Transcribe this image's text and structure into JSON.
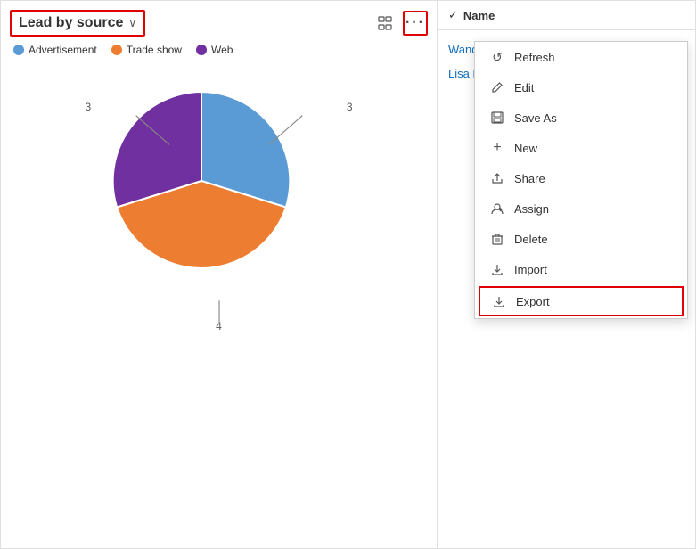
{
  "chart": {
    "title": "Lead by source",
    "chevron": "∨",
    "legend": [
      {
        "label": "Advertisement",
        "color": "#5b9bd5"
      },
      {
        "label": "Trade show",
        "color": "#ed7d31"
      },
      {
        "label": "Web",
        "color": "#7030a0"
      }
    ],
    "pie_labels": [
      {
        "value": "3",
        "position": "top-left"
      },
      {
        "value": "3",
        "position": "top-right"
      },
      {
        "value": "4",
        "position": "bottom"
      }
    ]
  },
  "right_panel": {
    "column_header": "Name",
    "names": [
      {
        "text": "Wanda Graves"
      },
      {
        "text": "Lisa Byrd"
      }
    ]
  },
  "menu": {
    "items": [
      {
        "id": "refresh",
        "label": "Refresh",
        "icon": "↺"
      },
      {
        "id": "edit",
        "label": "Edit",
        "icon": "✎"
      },
      {
        "id": "save-as",
        "label": "Save As",
        "icon": "⊞"
      },
      {
        "id": "new",
        "label": "New",
        "icon": "+"
      },
      {
        "id": "share",
        "label": "Share",
        "icon": "⇱"
      },
      {
        "id": "assign",
        "label": "Assign",
        "icon": "👤"
      },
      {
        "id": "delete",
        "label": "Delete",
        "icon": "🗑"
      },
      {
        "id": "import",
        "label": "Import",
        "icon": "⇑"
      },
      {
        "id": "export",
        "label": "Export",
        "icon": "⇓",
        "highlighted": true
      }
    ]
  }
}
